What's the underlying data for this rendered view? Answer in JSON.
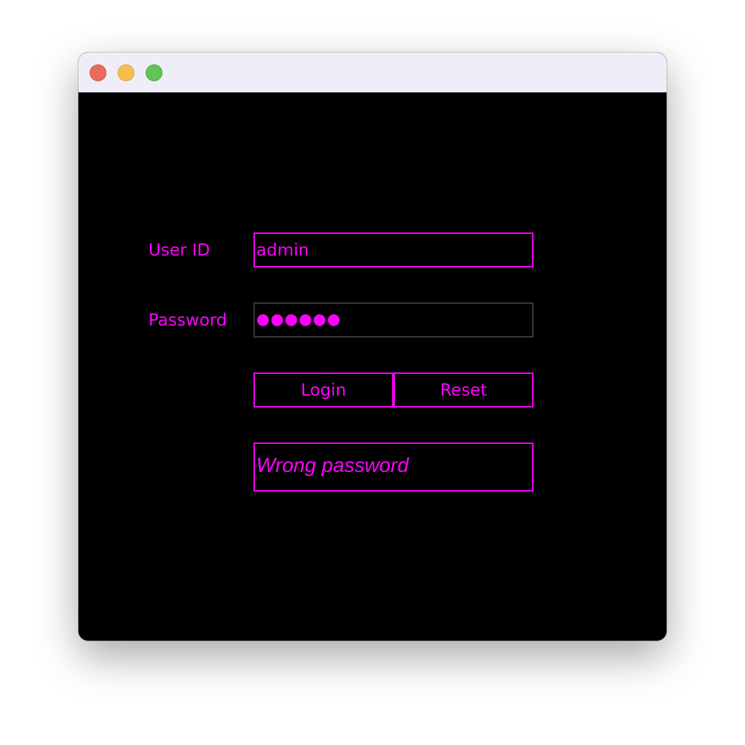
{
  "window": {
    "controls": {
      "close_color": "#ec6a5e",
      "minimize_color": "#f4bf4f",
      "zoom_color": "#61c554"
    }
  },
  "theme": {
    "background": "#000000",
    "accent": "#ff00ff",
    "titlebar": "#efedf7"
  },
  "form": {
    "user_id_label": "User ID",
    "user_id_value": "admin",
    "password_label": "Password",
    "password_masked": "●●●●●●",
    "login_label": "Login",
    "reset_label": "Reset",
    "message": "Wrong password"
  }
}
